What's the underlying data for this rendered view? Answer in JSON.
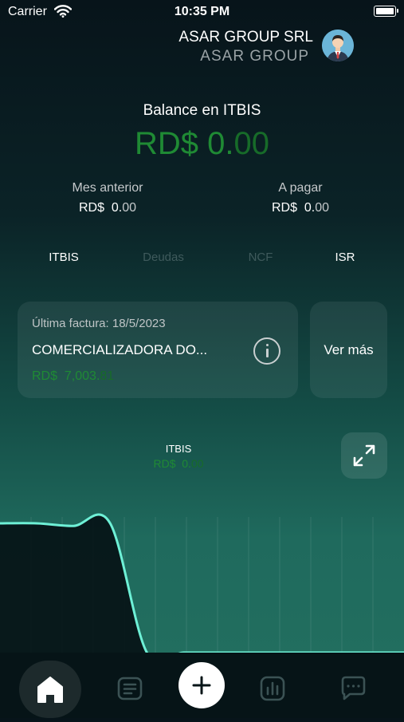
{
  "status_bar": {
    "carrier": "Carrier",
    "time": "10:35 PM"
  },
  "header": {
    "company": "ASAR GROUP SRL",
    "company_sub": "ASAR  GROUP"
  },
  "balance": {
    "label": "Balance en ITBIS",
    "currency": "RD$",
    "int": "0.",
    "dec": "00"
  },
  "summary": {
    "previous": {
      "label": "Mes anterior",
      "currency": "RD$",
      "int": "0.",
      "dec": "00"
    },
    "payable": {
      "label": "A pagar",
      "currency": "RD$",
      "int": "0.",
      "dec": "00"
    }
  },
  "tabs": [
    "ITBIS",
    "Deudas",
    "NCF",
    "ISR"
  ],
  "invoice": {
    "date_label": "Última factura: 18/5/2023",
    "name": "COMERCIALIZADORA DO...",
    "currency": "RD$",
    "int": "7,003.",
    "dec": "81"
  },
  "more_label": "Ver más",
  "chart": {
    "label": "ITBIS",
    "currency": "RD$",
    "int": "0.",
    "dec": "00"
  },
  "chart_data": {
    "type": "area",
    "title": "ITBIS",
    "x": [
      1,
      2,
      3,
      4,
      5,
      6,
      7,
      8,
      9,
      10,
      11,
      12
    ],
    "values": [
      100,
      100,
      98,
      100,
      0,
      0,
      0,
      0,
      0,
      0,
      0,
      0
    ],
    "grid": true,
    "line_color": "#6ef0d6"
  },
  "nav": [
    "home-icon",
    "document-list-icon",
    "plus-icon",
    "bar-chart-icon",
    "chat-icon"
  ],
  "colors": {
    "accent_green": "#1f8a34",
    "line": "#6ef0d6"
  }
}
